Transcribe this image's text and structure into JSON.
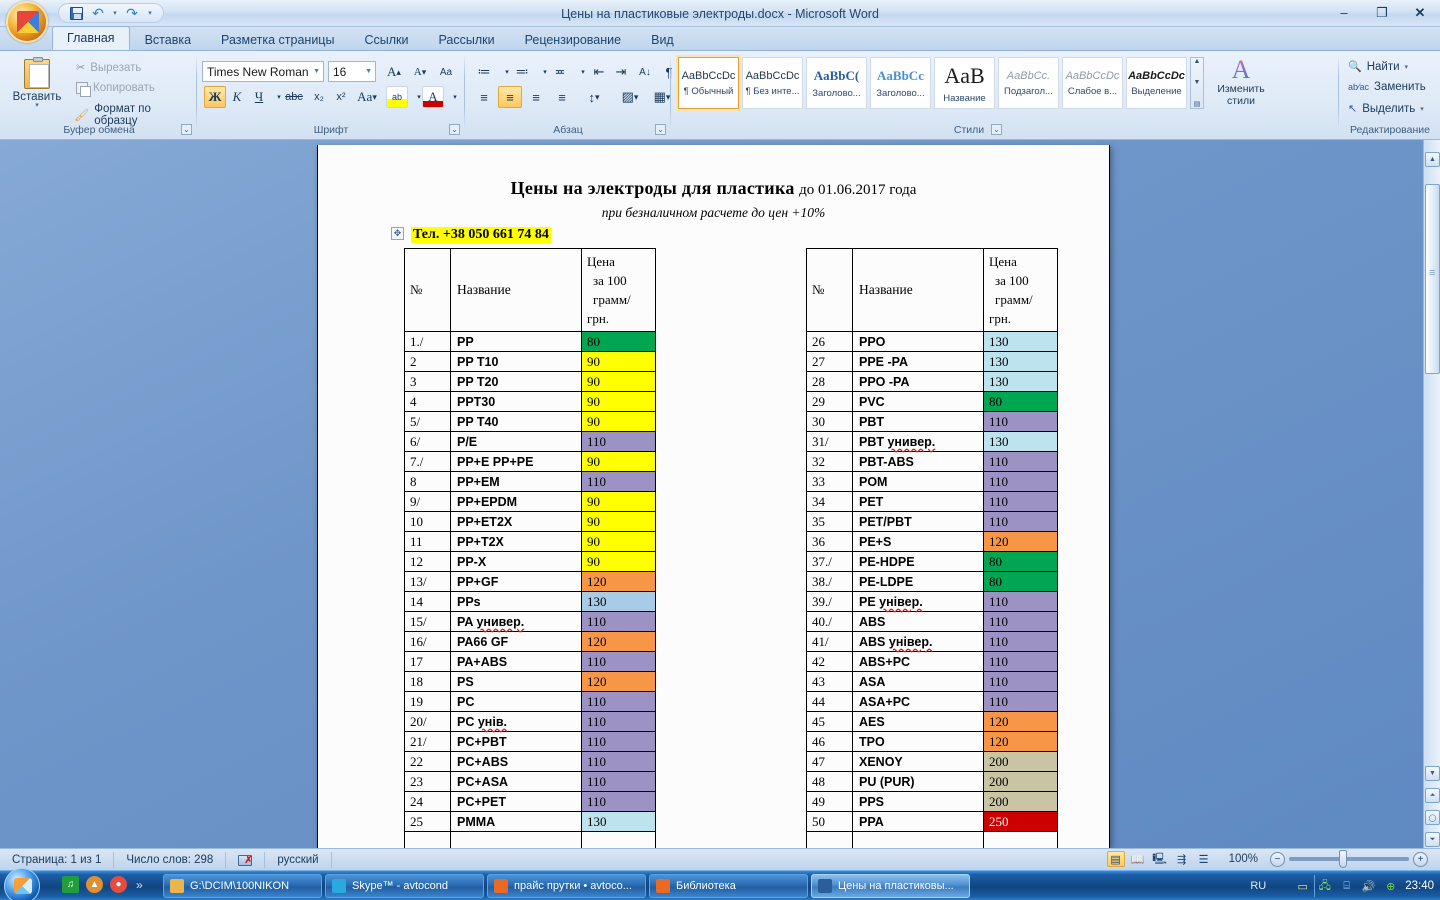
{
  "window": {
    "title": "Цены на пластиковые электроды.docx - Microsoft Word",
    "minimize": "–",
    "maximize": "❐",
    "close": "✕"
  },
  "quick_access": {
    "save": "save-icon",
    "undo": "↶",
    "redo": "↷",
    "customize": "▾"
  },
  "tabs": [
    {
      "label": "Главная",
      "active": true
    },
    {
      "label": "Вставка",
      "active": false
    },
    {
      "label": "Разметка страницы",
      "active": false
    },
    {
      "label": "Ссылки",
      "active": false
    },
    {
      "label": "Рассылки",
      "active": false
    },
    {
      "label": "Рецензирование",
      "active": false
    },
    {
      "label": "Вид",
      "active": false
    }
  ],
  "ribbon": {
    "clipboard": {
      "group_label": "Буфер обмена",
      "paste": "Вставить",
      "cut": "Вырезать",
      "copy": "Копировать",
      "format_painter": "Формат по образцу"
    },
    "font": {
      "group_label": "Шрифт",
      "font_name": "Times New Roman",
      "font_size": "16",
      "grow": "A",
      "shrink": "A",
      "clear_format": "Aa",
      "bold": "Ж",
      "italic": "К",
      "underline": "Ч",
      "strikethrough": "abc",
      "subscript": "x₂",
      "superscript": "x²",
      "change_case": "Aa",
      "highlight": "ab",
      "font_color": "A"
    },
    "paragraph": {
      "group_label": "Абзац",
      "bullets": "≔",
      "numbering": "≕",
      "multilevel": "≖",
      "decrease_indent": "⇤",
      "increase_indent": "⇥",
      "sort": "A↓",
      "show_marks": "¶",
      "align_left": "≡",
      "align_center": "≡",
      "align_right": "≡",
      "justify": "≡",
      "line_spacing": "↕",
      "shading": "▨",
      "borders": "▦"
    },
    "styles": {
      "group_label": "Стили",
      "items": [
        {
          "sample": "AaBbCcDc",
          "name": "¶ Обычный",
          "selected": true
        },
        {
          "sample": "AaBbCcDc",
          "name": "¶ Без инте...",
          "selected": false
        },
        {
          "sample": "AaBbC(",
          "name": "Заголово...",
          "selected": false
        },
        {
          "sample": "AaBbCc",
          "name": "Заголово...",
          "selected": false
        },
        {
          "sample": "AaB",
          "name": "Название",
          "selected": false
        },
        {
          "sample": "AaBbCc.",
          "name": "Подзагол...",
          "selected": false
        },
        {
          "sample": "AaBbCcDc",
          "name": "Слабое в...",
          "selected": false
        },
        {
          "sample": "AaBbCcDc",
          "name": "Выделение",
          "selected": false
        }
      ],
      "change_styles": "Изменить стили"
    },
    "editing": {
      "group_label": "Редактирование",
      "find": "Найти",
      "replace": "Заменить",
      "select": "Выделить"
    }
  },
  "document": {
    "title_bold": "Цены на электроды для пластика",
    "title_rest": "до  01.06.2017 года",
    "subtitle": "при безналичном расчете до цен +10%",
    "phone": "Тел. +38 050 661 74 84",
    "headers": {
      "num": "№",
      "name": "Название",
      "price_lines": [
        "Цена",
        "за 100",
        "грамм/",
        "грн."
      ]
    },
    "colors": {
      "green": "#00a651",
      "yellow": "#ffff00",
      "purple": "#9c93c4",
      "orange": "#f79646",
      "cyan": "#bde3ef",
      "lightblue": "#a8cbe8",
      "khaki": "#c9c5a4",
      "red": "#cc0000",
      "none": "#fcfcfc"
    },
    "left_table": [
      {
        "num": "1./",
        "name": "PP",
        "price": "80",
        "color": "green"
      },
      {
        "num": "2",
        "name": "PP T10",
        "price": "90",
        "color": "yellow"
      },
      {
        "num": "3",
        "name": "PP T20",
        "price": "90",
        "color": "yellow"
      },
      {
        "num": "4",
        "name": "PPT30",
        "price": "90",
        "color": "yellow"
      },
      {
        "num": "5/",
        "name": "PP T40",
        "price": "90",
        "color": "yellow"
      },
      {
        "num": "6/",
        "name": "P/E",
        "price": "110",
        "color": "purple"
      },
      {
        "num": "7./",
        "name": "PP+E  PP+PE",
        "price": "90",
        "color": "yellow"
      },
      {
        "num": "8",
        "name": "PP+EM",
        "price": "110",
        "color": "purple"
      },
      {
        "num": "9/",
        "name": "PP+EPDM",
        "price": "90",
        "color": "yellow"
      },
      {
        "num": "10",
        "name": "PP+ET2X",
        "price": "90",
        "color": "yellow"
      },
      {
        "num": "11",
        "name": "PP+T2X",
        "price": "90",
        "color": "yellow"
      },
      {
        "num": "12",
        "name": "PP-X",
        "price": "90",
        "color": "yellow"
      },
      {
        "num": "13/",
        "name": "PP+GF",
        "price": "120",
        "color": "orange"
      },
      {
        "num": "14",
        "name": "PPs",
        "price": "130",
        "color": "lightblue"
      },
      {
        "num": "15/",
        "name": "PA универ.",
        "price": "110",
        "color": "purple",
        "squiggle": "универ."
      },
      {
        "num": "16/",
        "name": "PA66 GF",
        "price": "120",
        "color": "orange"
      },
      {
        "num": "17",
        "name": "PA+ABS",
        "price": "110",
        "color": "purple"
      },
      {
        "num": "18",
        "name": "PS",
        "price": "120",
        "color": "orange"
      },
      {
        "num": "19",
        "name": "PC",
        "price": "110",
        "color": "purple"
      },
      {
        "num": "20/",
        "name": "PC унів.",
        "price": "110",
        "color": "purple",
        "squiggle": "унів."
      },
      {
        "num": "21/",
        "name": "PC+PBT",
        "price": "110",
        "color": "purple"
      },
      {
        "num": "22",
        "name": "PC+ABS",
        "price": "110",
        "color": "purple"
      },
      {
        "num": "23",
        "name": "PC+ASA",
        "price": "110",
        "color": "purple"
      },
      {
        "num": "24",
        "name": "PC+PET",
        "price": "110",
        "color": "purple"
      },
      {
        "num": "25",
        "name": "PMMA",
        "price": "130",
        "color": "cyan"
      },
      {
        "num": "",
        "name": "",
        "price": "",
        "color": "none"
      }
    ],
    "right_table": [
      {
        "num": "26",
        "name": "PPO",
        "price": "130",
        "color": "cyan"
      },
      {
        "num": "27",
        "name": "PPE -PA",
        "price": "130",
        "color": "cyan"
      },
      {
        "num": "28",
        "name": "PPO -PA",
        "price": "130",
        "color": "cyan"
      },
      {
        "num": "29",
        "name": "PVC",
        "price": "80",
        "color": "green"
      },
      {
        "num": "30",
        "name": "PBT",
        "price": "110",
        "color": "purple"
      },
      {
        "num": "31/",
        "name": "PBT универ.",
        "price": "130",
        "color": "cyan",
        "squiggle": "универ."
      },
      {
        "num": "32",
        "name": "PBT-ABS",
        "price": "110",
        "color": "purple"
      },
      {
        "num": "33",
        "name": "POM",
        "price": "110",
        "color": "purple"
      },
      {
        "num": "34",
        "name": "PET",
        "price": "110",
        "color": "purple"
      },
      {
        "num": "35",
        "name": "PET/PBT",
        "price": "110",
        "color": "purple"
      },
      {
        "num": "36",
        "name": "PE+S",
        "price": "120",
        "color": "orange"
      },
      {
        "num": "37./",
        "name": "PE-HDPE",
        "price": "80",
        "color": "green"
      },
      {
        "num": "38./",
        "name": "PE-LDPE",
        "price": "80",
        "color": "green"
      },
      {
        "num": "39./",
        "name": "PE універ.",
        "price": "110",
        "color": "purple",
        "squiggle": "універ."
      },
      {
        "num": "40./",
        "name": "ABS",
        "price": "110",
        "color": "purple"
      },
      {
        "num": "41/",
        "name": "ABS універ.",
        "price": "110",
        "color": "purple",
        "squiggle": "універ."
      },
      {
        "num": "42",
        "name": "ABS+PC",
        "price": "110",
        "color": "purple"
      },
      {
        "num": "43",
        "name": "ASA",
        "price": "110",
        "color": "purple"
      },
      {
        "num": "44",
        "name": "ASA+PC",
        "price": "110",
        "color": "purple"
      },
      {
        "num": "45",
        "name": "AES",
        "price": "120",
        "color": "orange"
      },
      {
        "num": "46",
        "name": "TPO",
        "price": "120",
        "color": "orange"
      },
      {
        "num": "47",
        "name": "XENOY",
        "price": "200",
        "color": "khaki"
      },
      {
        "num": "48",
        "name": "PU (PUR)",
        "price": "200",
        "color": "khaki"
      },
      {
        "num": "49",
        "name": "PPS",
        "price": "200",
        "color": "khaki"
      },
      {
        "num": "50",
        "name": "PPA",
        "price": "250",
        "color": "red"
      },
      {
        "num": "",
        "name": "",
        "price": "",
        "color": "none"
      }
    ]
  },
  "statusbar": {
    "page": "Страница: 1 из 1",
    "words": "Число слов: 298",
    "language": "русский",
    "zoom": "100%",
    "views": [
      "print-layout",
      "full-screen-reading",
      "web-layout",
      "outline",
      "draft"
    ]
  },
  "taskbar": {
    "start": "start-orb",
    "quick_launch": [
      "media-icon",
      "alert-icon",
      "chrome-icon"
    ],
    "quick_more": "»",
    "buttons": [
      {
        "label": "G:\\DCIM\\100NIKON",
        "icon": "folder-icon",
        "active": false
      },
      {
        "label": "Skype™ - avtocond",
        "icon": "skype-icon",
        "active": false
      },
      {
        "label": "прайс прутки • avtoco...",
        "icon": "firefox-icon",
        "active": false
      },
      {
        "label": "Библиотека",
        "icon": "firefox-icon",
        "active": false
      },
      {
        "label": "Цены на пластиковы...",
        "icon": "word-icon",
        "active": true
      }
    ],
    "lang": "RU",
    "clock": "23:40"
  }
}
